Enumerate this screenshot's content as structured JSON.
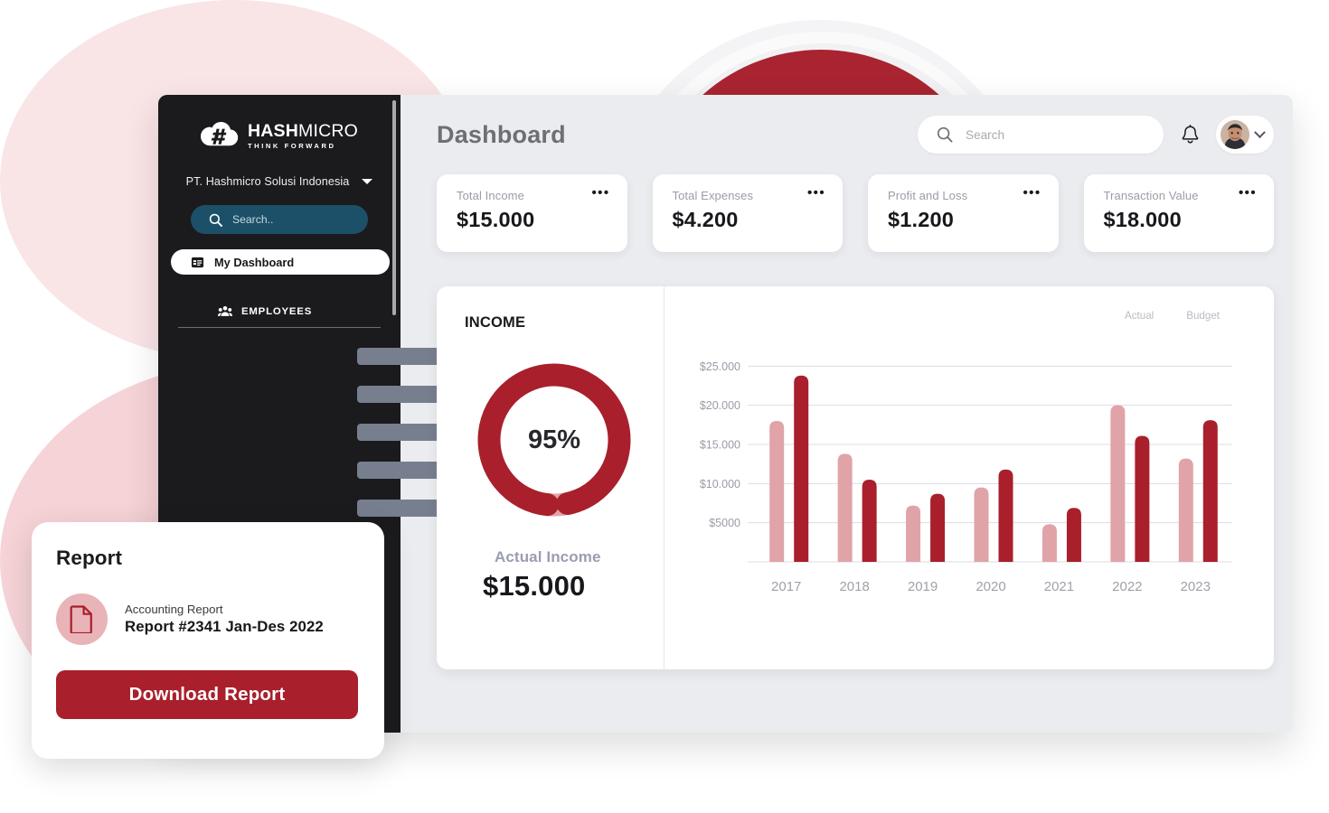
{
  "brand": {
    "logo_main": "HASH",
    "logo_main_light": "MICRO",
    "logo_tagline": "THINK FORWARD",
    "accent_dark": "#a91f2c",
    "accent_light": "#e0a3a8",
    "sidebar_bg": "#1b1b1d",
    "search_bg": "#1c5068"
  },
  "sidebar": {
    "company": "PT. Hashmicro Solusi Indonesia",
    "search_placeholder": "Search..",
    "active_item": "My Dashboard",
    "section_label": "EMPLOYEES",
    "skeleton_widths": [
      92,
      92,
      92,
      134,
      134
    ]
  },
  "header": {
    "title": "Dashboard",
    "search_placeholder": "Search"
  },
  "kpis": [
    {
      "label": "Total Income",
      "value": "$15.000",
      "menu": "•••"
    },
    {
      "label": "Total Expenses",
      "value": "$4.200",
      "menu": "•••"
    },
    {
      "label": "Profit and Loss",
      "value": "$1.200",
      "menu": "•••"
    },
    {
      "label": "Transaction Value",
      "value": "$18.000",
      "menu": "•••"
    }
  ],
  "income": {
    "title": "INCOME",
    "percent_label": "95%",
    "percent_value": 95,
    "actual_label": "Actual Income",
    "actual_value": "$15.000"
  },
  "chart_data": {
    "type": "bar",
    "title": "",
    "xlabel": "",
    "ylabel": "",
    "categories": [
      "2017",
      "2018",
      "2019",
      "2020",
      "2021",
      "2022",
      "2023"
    ],
    "ytick_labels": [
      "$5000",
      "$10.000",
      "$15.000",
      "$20.000",
      "$25.000"
    ],
    "ytick_values": [
      5000,
      10000,
      15000,
      20000,
      25000
    ],
    "ylim": [
      0,
      27000
    ],
    "grid": true,
    "legend_position": "top-right",
    "series": [
      {
        "name": "Actual",
        "color": "#e0a3a8",
        "values": [
          18000,
          13800,
          7200,
          9500,
          4800,
          20000,
          13200
        ]
      },
      {
        "name": "Budget",
        "color": "#a91f2c",
        "values": [
          23800,
          10500,
          8700,
          11800,
          6900,
          16100,
          18100
        ]
      }
    ]
  },
  "report": {
    "title": "Report",
    "subtitle": "Accounting Report",
    "name": "Report #2341 Jan-Des 2022",
    "button_label": "Download Report"
  }
}
